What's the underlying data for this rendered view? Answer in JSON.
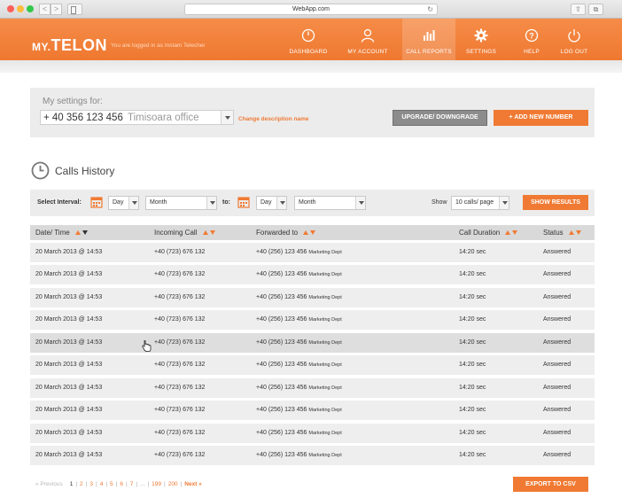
{
  "browser": {
    "url": "WebApp.com",
    "back_glyph": "<",
    "forward_glyph": ">",
    "reload_glyph": "↻",
    "share_glyph": "⇪",
    "tabs_glyph": "⧉"
  },
  "header": {
    "logo_prefix": "MY.",
    "logo_main": "TELON",
    "logged_in_text": "You are logged in as Instam Telecher",
    "nav": [
      {
        "label": "DASHBOARD",
        "icon": "dashboard-icon"
      },
      {
        "label": "MY ACCOUNT",
        "icon": "user-icon"
      },
      {
        "label": "CALL REPORTS",
        "icon": "bar-chart-icon",
        "active": true
      },
      {
        "label": "SETTINGS",
        "icon": "gear-icon"
      },
      {
        "label": "HELP",
        "icon": "help-icon"
      },
      {
        "label": "LOG OUT",
        "icon": "power-icon"
      }
    ],
    "accent_color": "#f07a33"
  },
  "settings": {
    "label": "My settings for:",
    "phone_number": "+ 40 356 123 456",
    "phone_description": "Timisoara office",
    "change_link": "Change description name",
    "upgrade_button": "UPGRADE/ DOWNGRADE",
    "add_button": "+ ADD NEW NUMBER"
  },
  "history": {
    "title": "Calls History"
  },
  "filter": {
    "select_interval_label": "Select Interval:",
    "from_day": "Day",
    "from_month": "Month",
    "to_label": "to:",
    "to_day": "Day",
    "to_month": "Month",
    "show_label": "Show",
    "per_page": "10 calls/ page",
    "show_button": "SHOW RESULTS"
  },
  "table": {
    "columns": [
      "Date/ Time",
      "Incoming Call",
      "Forwarded to",
      "Call Duration",
      "Status"
    ],
    "rows": [
      {
        "date": "20 March 2013 @ 14:53",
        "incoming": "+40 (723) 676 132",
        "forwarded": "+40 (256) 123 456",
        "dept": "Marketing Dept",
        "duration": "14:20 sec",
        "status": "Answered"
      },
      {
        "date": "20 March 2013 @ 14:53",
        "incoming": "+40 (723) 676 132",
        "forwarded": "+40 (256) 123 456",
        "dept": "Marketing Dept",
        "duration": "14:20 sec",
        "status": "Answered"
      },
      {
        "date": "20 March 2013 @ 14:53",
        "incoming": "+40 (723) 676 132",
        "forwarded": "+40 (256) 123 456",
        "dept": "Marketing Dept",
        "duration": "14:20 sec",
        "status": "Answered"
      },
      {
        "date": "20 March 2013 @ 14:53",
        "incoming": "+40 (723) 676 132",
        "forwarded": "+40 (256) 123 456",
        "dept": "Marketing Dept",
        "duration": "14:20 sec",
        "status": "Answered"
      },
      {
        "date": "20 March 2013 @ 14:53",
        "incoming": "+40 (723) 676 132",
        "forwarded": "+40 (256) 123 456",
        "dept": "Marketing Dept",
        "duration": "14:20 sec",
        "status": "Answered",
        "hover": true
      },
      {
        "date": "20 March 2013 @ 14:53",
        "incoming": "+40 (723) 676 132",
        "forwarded": "+40 (256) 123 456",
        "dept": "Marketing Dept",
        "duration": "14:20 sec",
        "status": "Answered"
      },
      {
        "date": "20 March 2013 @ 14:53",
        "incoming": "+40 (723) 676 132",
        "forwarded": "+40 (256) 123 456",
        "dept": "Marketing Dept",
        "duration": "14:20 sec",
        "status": "Answered"
      },
      {
        "date": "20 March 2013 @ 14:53",
        "incoming": "+40 (723) 676 132",
        "forwarded": "+40 (256) 123 456",
        "dept": "Marketing Dept",
        "duration": "14:20 sec",
        "status": "Answered"
      },
      {
        "date": "20 March 2013 @ 14:53",
        "incoming": "+40 (723) 676 132",
        "forwarded": "+40 (256) 123 456",
        "dept": "Marketing Dept",
        "duration": "14:20 sec",
        "status": "Answered"
      },
      {
        "date": "20 March 2013 @ 14:53",
        "incoming": "+40 (723) 676 132",
        "forwarded": "+40 (256) 123 456",
        "dept": "Marketing Dept",
        "duration": "14:20 sec",
        "status": "Answered"
      }
    ]
  },
  "pagination": {
    "previous": "« Previous",
    "pages": [
      "1",
      "2",
      "3",
      "4",
      "5",
      "6",
      "7"
    ],
    "ellipsis": "...",
    "late_pages": [
      "199",
      "200"
    ],
    "current": "1",
    "next": "Next »"
  },
  "export_button": "EXPORT TO CSV"
}
